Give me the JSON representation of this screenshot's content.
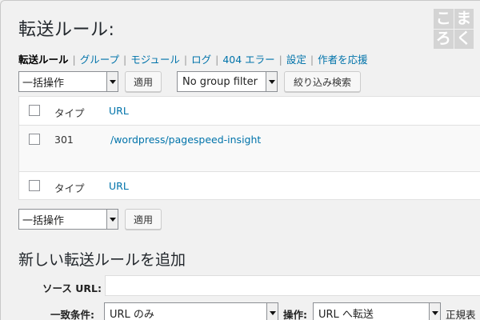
{
  "page": {
    "title": "転送ルール:"
  },
  "logo": [
    "こ",
    "ま",
    "ろ",
    "く"
  ],
  "subnav": [
    {
      "label": "転送ルール",
      "current": true
    },
    {
      "label": "グループ"
    },
    {
      "label": "モジュール"
    },
    {
      "label": "ログ"
    },
    {
      "label": "404 エラー"
    },
    {
      "label": "設定"
    },
    {
      "label": "作者を応援"
    }
  ],
  "subnav_separator": "|",
  "toolbar_top": {
    "bulk_action": "一括操作",
    "apply": "適用",
    "group_filter": "No group filter",
    "filter_button": "絞り込み検索"
  },
  "table": {
    "header": {
      "type": "タイプ",
      "url": "URL"
    },
    "rows": [
      {
        "type": "301",
        "url": "/wordpress/pagespeed-insight"
      }
    ],
    "footer": {
      "type": "タイプ",
      "url": "URL"
    }
  },
  "toolbar_bottom": {
    "bulk_action": "一括操作",
    "apply": "適用"
  },
  "add_rule": {
    "title": "新しい転送ルールを追加",
    "source_label": "ソース URL:",
    "source_value": "",
    "match_label": "一致条件:",
    "match_value": "URL のみ",
    "action_label": "操作:",
    "action_value": "URL へ転送",
    "regex_label": "正規表"
  }
}
